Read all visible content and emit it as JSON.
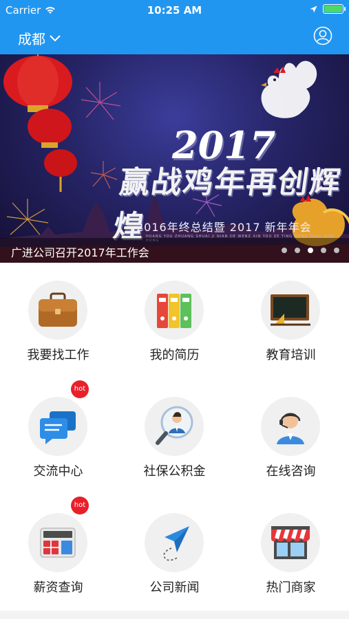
{
  "status_bar": {
    "carrier": "Carrier",
    "time": "10:25 AM"
  },
  "nav": {
    "city": "成都"
  },
  "banner": {
    "year": "2017",
    "headline": "赢战鸡年再创辉煌",
    "subtitle": "2016年终总结暨 2017 新年年会",
    "pinyin": "HUANG YOU ZHUANG SHUAI JI NIAN DE WENZ XIN YOU ZE TING WENG TANG XINS HONG",
    "caption": "广进公司召开2017年工作会",
    "dots": 5,
    "active_dot": 2
  },
  "menu": [
    {
      "label": "我要找工作",
      "icon": "briefcase-icon",
      "hot": false
    },
    {
      "label": "我的简历",
      "icon": "folders-icon",
      "hot": false
    },
    {
      "label": "教育培训",
      "icon": "blackboard-icon",
      "hot": false
    },
    {
      "label": "交流中心",
      "icon": "chat-bubbles-icon",
      "hot": true
    },
    {
      "label": "社保公积金",
      "icon": "person-search-icon",
      "hot": false
    },
    {
      "label": "在线咨询",
      "icon": "headset-agent-icon",
      "hot": false
    },
    {
      "label": "薪资查询",
      "icon": "calculator-icon",
      "hot": true
    },
    {
      "label": "公司新闻",
      "icon": "paper-plane-icon",
      "hot": false
    },
    {
      "label": "热门商家",
      "icon": "storefront-icon",
      "hot": false
    }
  ],
  "hot_label": "hot",
  "colors": {
    "brand": "#2196f0",
    "hot": "#e8202a"
  }
}
